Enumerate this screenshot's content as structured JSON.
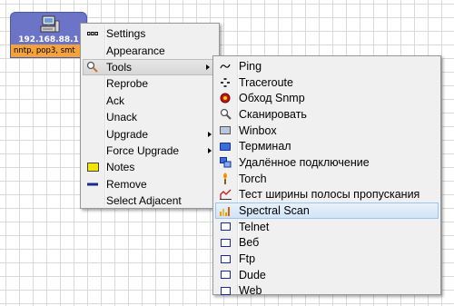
{
  "device": {
    "ip": "192.168.88.1",
    "services": "nntp, pop3, smt",
    "icon": "computer-icon",
    "color": "#6c74c8",
    "service_bar_color": "#f4a33a"
  },
  "main_menu": {
    "items": [
      {
        "label": "Settings",
        "icon": "dots-icon"
      },
      {
        "label": "Appearance"
      },
      {
        "label": "Tools",
        "icon": "magnifier-icon",
        "submenu": true,
        "highlighted": true
      },
      {
        "label": "Reprobe"
      },
      {
        "label": "Ack"
      },
      {
        "label": "Unack"
      },
      {
        "label": "Upgrade",
        "submenu": true
      },
      {
        "label": "Force Upgrade",
        "submenu": true
      },
      {
        "label": "Notes",
        "icon": "note-icon"
      },
      {
        "label": "Remove",
        "icon": "minus-icon"
      },
      {
        "label": "Select Adjacent"
      }
    ]
  },
  "tools_menu": {
    "items": [
      {
        "label": "Ping",
        "icon": "ping-icon"
      },
      {
        "label": "Traceroute",
        "icon": "traceroute-icon"
      },
      {
        "label": "Обход Snmp",
        "icon": "snmp-icon"
      },
      {
        "label": "Сканировать",
        "icon": "scan-icon"
      },
      {
        "label": "Winbox",
        "icon": "winbox-icon"
      },
      {
        "label": "Терминал",
        "icon": "terminal-icon"
      },
      {
        "label": "Удалённое подключение",
        "icon": "remote-icon"
      },
      {
        "label": "Torch",
        "icon": "torch-icon"
      },
      {
        "label": "Тест ширины полосы пропускания",
        "icon": "bandwidth-icon"
      },
      {
        "label": "Spectral Scan",
        "icon": "spectral-icon",
        "highlighted": true
      },
      {
        "label": "Telnet",
        "icon": "window-icon"
      },
      {
        "label": "Веб",
        "icon": "window-icon"
      },
      {
        "label": "Ftp",
        "icon": "window-icon"
      },
      {
        "label": "Dude",
        "icon": "window-icon"
      },
      {
        "label": "Web",
        "icon": "window-icon"
      }
    ]
  },
  "colors": {
    "highlight_gray": "#d6d6d6",
    "highlight_blue": "#cfe3f7",
    "menu_bg": "#f0f0f0"
  }
}
